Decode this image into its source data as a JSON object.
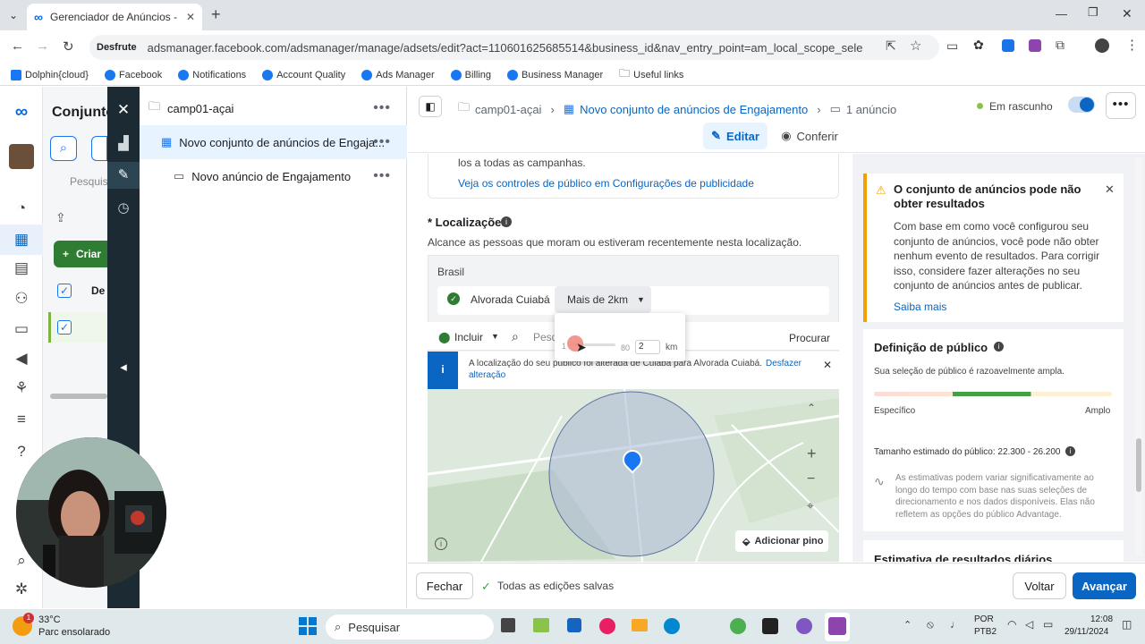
{
  "browser": {
    "tab_title": "Gerenciador de Anúncios - Ger",
    "profile_label": "Desfrute",
    "url": "adsmanager.facebook.com/adsmanager/manage/adsets/edit?act=110601625685514&business_id&nav_entry_point=am_local_scope_selector&selected_ca...",
    "bookmarks": [
      "Dolphin{cloud}",
      "Facebook",
      "Notifications",
      "Account Quality",
      "Ads Manager",
      "Billing",
      "Business Manager",
      "Useful links"
    ]
  },
  "left_panel": {
    "title": "Conjunto",
    "search_placeholder": "Pesquisa",
    "create_button": "Criar",
    "col_head": "De"
  },
  "tree": {
    "campaign": "camp01-açai",
    "adset": "Novo conjunto de anúncios de Engaja...",
    "ad": "Novo anúncio de Engajamento"
  },
  "topbar": {
    "crumb_campaign": "camp01-açai",
    "crumb_adset": "Novo conjunto de anúncios de Engajamento",
    "crumb_ads": "1 anúncio",
    "status": "Em rascunho",
    "edit_label": "Editar",
    "review_label": "Conferir"
  },
  "main": {
    "top_text": "los a todas as campanhas.",
    "top_link": "Veja os controles de público em Configurações de publicidade",
    "locations_label": "* Localizações",
    "locations_desc": "Alcance as pessoas que moram ou estiveram recentemente nesta localização.",
    "country": "Brasil",
    "location_name": "Alvorada Cuiabá",
    "radius_label": "Mais de 2km",
    "slider_min": "1",
    "slider_max": "80",
    "radius_value": "2",
    "radius_unit": "km",
    "include_label": "Incluir",
    "search_placeholder": "Pesq",
    "browse_label": "Procurar",
    "notice_text": "A localização do seu público foi alterada de Cuiabá para Alvorada Cuiabá.",
    "undo_label": "Desfazer",
    "undo_label2": "alteração",
    "add_pin": "Adicionar pino"
  },
  "right": {
    "warning_title": "O conjunto de anúncios pode não obter resultados",
    "warning_body": "Com base em como você configurou seu conjunto de anúncios, você pode não obter nenhum evento de resultados. Para corrigir isso, considere fazer alterações no seu conjunto de anúncios antes de publicar.",
    "learn_more": "Saiba mais",
    "audience_title": "Definição de público",
    "audience_desc": "Sua seleção de público é razoavelmente ampla.",
    "specific": "Específico",
    "broad": "Amplo",
    "size_text": "Tamanho estimado do público: 22.300 - 26.200",
    "estimate_note": "As estimativas podem variar significativamente ao longo do tempo com base nas suas seleções de direcionamento e nos dados disponíveis. Elas não refletem as opções do público Advantage.",
    "daily_title": "Estimativa de resultados diários"
  },
  "bottom": {
    "close": "Fechar",
    "saved": "Todas as edições salvas",
    "back": "Voltar",
    "next": "Avançar"
  },
  "taskbar": {
    "temp": "33°C",
    "weather": "Parc ensolarado",
    "search": "Pesquisar",
    "lang1": "POR",
    "lang2": "PTB2",
    "time": "12:08",
    "date": "29/11/2024",
    "weather_badge": "1"
  },
  "colors": {
    "accent": "#0a66c2",
    "create_green": "#2e7d32",
    "warning": "#f0a000",
    "darkbar": "#1c2b33"
  }
}
